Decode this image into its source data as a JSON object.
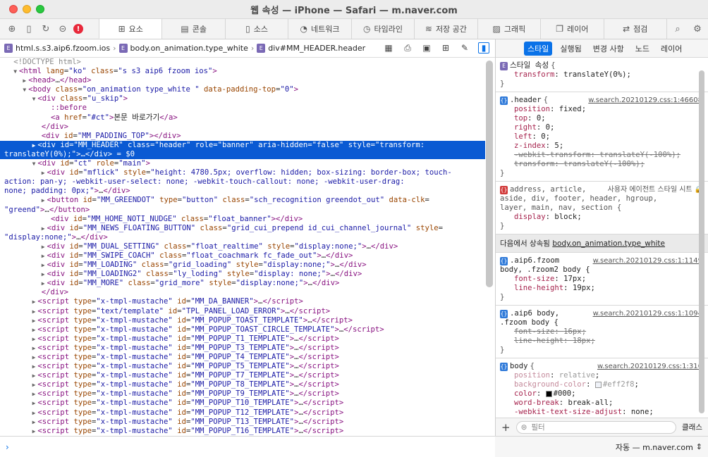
{
  "window": {
    "title": "웹 속성 — iPhone — Safari — m.naver.com"
  },
  "tabbar": {
    "tabs": [
      {
        "label": "요소",
        "icon": "elements-icon",
        "glyph": "⊞",
        "active": true
      },
      {
        "label": "콘솔",
        "icon": "console-icon",
        "glyph": "▤",
        "active": false
      },
      {
        "label": "소스",
        "icon": "sources-icon",
        "glyph": "▯",
        "active": false
      },
      {
        "label": "네트워크",
        "icon": "network-icon",
        "glyph": "◔",
        "active": false
      },
      {
        "label": "타임라인",
        "icon": "timeline-icon",
        "glyph": "◷",
        "active": false
      },
      {
        "label": "저장 공간",
        "icon": "storage-icon",
        "glyph": "≋",
        "active": false
      },
      {
        "label": "그래픽",
        "icon": "graphics-icon",
        "glyph": "▨",
        "active": false
      },
      {
        "label": "레이어",
        "icon": "layers-icon",
        "glyph": "❐",
        "active": false
      },
      {
        "label": "점검",
        "icon": "audit-icon",
        "glyph": "⇄",
        "active": false
      }
    ]
  },
  "breadcrumb": {
    "items": [
      "html.s.s3.aip6.fzoom.ios",
      "body.on_animation.type_white",
      "div#MM_HEADER.header"
    ],
    "badge": "E"
  },
  "dom": {
    "lines": [
      {
        "indent": 2,
        "arrow": "",
        "html": "<span class='cm'>&lt;!DOCTYPE html&gt;</span>"
      },
      {
        "indent": 2,
        "arrow": "▼",
        "html": "<span class='tg'>&lt;html</span> <span class='an'>lang</span>=<span class='av'>\"ko\"</span> <span class='an'>class</span>=<span class='av'>\"s s3 aip6 fzoom ios\"</span><span class='tg'>&gt;</span>"
      },
      {
        "indent": 4,
        "arrow": "▶",
        "html": "<span class='tg'>&lt;head&gt;</span>…<span class='tg'>&lt;/head&gt;</span>"
      },
      {
        "indent": 4,
        "arrow": "▼",
        "html": "<span class='tg'>&lt;body</span> <span class='an'>class</span>=<span class='av'>\"on_animation type_white \"</span> <span class='an'>data-padding-top</span>=<span class='av'>\"0\"</span><span class='tg'>&gt;</span>"
      },
      {
        "indent": 6,
        "arrow": "▼",
        "html": "<span class='tg'>&lt;div</span> <span class='an'>class</span>=<span class='av'>\"u_skip\"</span><span class='tg'>&gt;</span>"
      },
      {
        "indent": 10,
        "arrow": "",
        "html": "<span class='tg'>::before</span>"
      },
      {
        "indent": 10,
        "arrow": "",
        "html": "<span class='tg'>&lt;a</span> <span class='an'>href</span>=<span class='av'>\"#ct\"</span><span class='tg'>&gt;</span><span class='tx'>본문 바로가기</span><span class='tg'>&lt;/a&gt;</span>"
      },
      {
        "indent": 8,
        "arrow": "",
        "html": "<span class='tg'>&lt;/div&gt;</span>"
      },
      {
        "indent": 8,
        "arrow": "",
        "html": "<span class='tg'>&lt;div</span> <span class='an'>id</span>=<span class='av'>\"MM_PADDING_TOP\"</span><span class='tg'>&gt;&lt;/div&gt;</span>"
      },
      {
        "indent": 6,
        "arrow": "▶",
        "selected": true,
        "html": "<span class='tg'>&lt;div</span> <span class='an'>id</span>=<span class='av'>\"MM_HEADER\"</span> <span class='an'>class</span>=<span class='av'>\"header\"</span> <span class='an'>role</span>=<span class='av'>\"banner\"</span> <span class='an'>aria-hidden</span>=<span class='av'>\"false\"</span> <span class='an'>style</span>=<span class='av'>\"transform: </span>"
      },
      {
        "indent": 0,
        "arrow": "",
        "selected": true,
        "html": "<span class='av'>translateY(0%);\"</span><span class='tg'>&gt;</span>…<span class='tg'>&lt;/div&gt;</span> = $0"
      },
      {
        "indent": 6,
        "arrow": "▼",
        "html": "<span class='tg'>&lt;div</span> <span class='an'>id</span>=<span class='av'>\"ct\"</span> <span class='an'>role</span>=<span class='av'>\"main\"</span><span class='tg'>&gt;</span>"
      },
      {
        "indent": 8,
        "arrow": "▶",
        "html": "<span class='tg'>&lt;div</span> <span class='an'>id</span>=<span class='av'>\"mflick\"</span> <span class='an'>style</span>=<span class='av'>\"height: 4780.5px; overflow: hidden; box-sizing: border-box; touch-</span>"
      },
      {
        "indent": 0,
        "arrow": "",
        "html": "<span class='av'>action: pan-y; -webkit-user-select: none; -webkit-touch-callout: none; -webkit-user-drag: </span>"
      },
      {
        "indent": 0,
        "arrow": "",
        "html": "<span class='av'>none; padding: 0px;\"</span><span class='tg'>&gt;</span>…<span class='tg'>&lt;/div&gt;</span>"
      },
      {
        "indent": 8,
        "arrow": "▶",
        "html": "<span class='tg'>&lt;button</span> <span class='an'>id</span>=<span class='av'>\"MM_GREENDOT\"</span> <span class='an'>type</span>=<span class='av'>\"button\"</span> <span class='an'>class</span>=<span class='av'>\"sch_recognition greendot_out\"</span> <span class='an'>data-clk</span>=</span>"
      },
      {
        "indent": 0,
        "arrow": "",
        "html": "<span class='av'>\"greend\"</span><span class='tg'>&gt;</span>…<span class='tg'>&lt;/button&gt;</span>"
      },
      {
        "indent": 10,
        "arrow": "",
        "html": "<span class='tg'>&lt;div</span> <span class='an'>id</span>=<span class='av'>\"MM_HOME_NOTI_NUDGE\"</span> <span class='an'>class</span>=<span class='av'>\"float_banner\"</span><span class='tg'>&gt;&lt;/div&gt;</span>"
      },
      {
        "indent": 8,
        "arrow": "▶",
        "html": "<span class='tg'>&lt;div</span> <span class='an'>id</span>=<span class='av'>\"MM_NEWS_FLOATING_BUTTON\"</span> <span class='an'>class</span>=<span class='av'>\"grid_cui_prepend id_cui_channel_journal\"</span> <span class='an'>style</span>=</span>"
      },
      {
        "indent": 0,
        "arrow": "",
        "html": "<span class='av'>\"display:none;\"</span><span class='tg'>&gt;</span>…<span class='tg'>&lt;/div&gt;</span>"
      },
      {
        "indent": 8,
        "arrow": "▶",
        "html": "<span class='tg'>&lt;div</span> <span class='an'>id</span>=<span class='av'>\"MM_DUAL_SETTING\"</span> <span class='an'>class</span>=<span class='av'>\"float_realtime\"</span> <span class='an'>style</span>=<span class='av'>\"display:none;\"</span><span class='tg'>&gt;</span>…<span class='tg'>&lt;/div&gt;</span>"
      },
      {
        "indent": 8,
        "arrow": "▶",
        "html": "<span class='tg'>&lt;div</span> <span class='an'>id</span>=<span class='av'>\"MM_SWIPE_COACH\"</span> <span class='an'>class</span>=<span class='av'>\"float_coachmark fc_fade_out\"</span><span class='tg'>&gt;</span>…<span class='tg'>&lt;/div&gt;</span>"
      },
      {
        "indent": 8,
        "arrow": "▶",
        "html": "<span class='tg'>&lt;div</span> <span class='an'>id</span>=<span class='av'>\"MM_LOADING\"</span> <span class='an'>class</span>=<span class='av'>\"grid_loading\"</span> <span class='an'>style</span>=<span class='av'>\"display:none;\"</span><span class='tg'>&gt;</span>…<span class='tg'>&lt;/div&gt;</span>"
      },
      {
        "indent": 8,
        "arrow": "▶",
        "html": "<span class='tg'>&lt;div</span> <span class='an'>id</span>=<span class='av'>\"MM_LOADING2\"</span> <span class='an'>class</span>=<span class='av'>\"ly_loding\"</span> <span class='an'>style</span>=<span class='av'>\"display: none;\"</span><span class='tg'>&gt;</span>…<span class='tg'>&lt;/div&gt;</span>"
      },
      {
        "indent": 8,
        "arrow": "▶",
        "html": "<span class='tg'>&lt;div</span> <span class='an'>id</span>=<span class='av'>\"MM_MORE\"</span> <span class='an'>class</span>=<span class='av'>\"grid_more\"</span> <span class='an'>style</span>=<span class='av'>\"display:none;\"</span><span class='tg'>&gt;</span>…<span class='tg'>&lt;/div&gt;</span>"
      },
      {
        "indent": 8,
        "arrow": "",
        "html": "<span class='tg'>&lt;/div&gt;</span>"
      },
      {
        "indent": 6,
        "arrow": "▶",
        "html": "<span class='tg'>&lt;script</span> <span class='an'>type</span>=<span class='av'>\"x-tmpl-mustache\"</span> <span class='an'>id</span>=<span class='av'>\"MM_DA_BANNER\"</span><span class='tg'>&gt;</span>…<span class='tg'>&lt;/script&gt;</span>"
      },
      {
        "indent": 6,
        "arrow": "▶",
        "html": "<span class='tg'>&lt;script</span> <span class='an'>type</span>=<span class='av'>\"text/template\"</span> <span class='an'>id</span>=<span class='av'>\"TPL_PANEL_LOAD_ERROR\"</span><span class='tg'>&gt;</span>…<span class='tg'>&lt;/script&gt;</span>"
      },
      {
        "indent": 6,
        "arrow": "▶",
        "html": "<span class='tg'>&lt;script</span> <span class='an'>type</span>=<span class='av'>\"x-tmpl-mustache\"</span> <span class='an'>id</span>=<span class='av'>\"MM_POPUP_TOAST_TEMPLATE\"</span><span class='tg'>&gt;</span>…<span class='tg'>&lt;/script&gt;</span>"
      },
      {
        "indent": 6,
        "arrow": "▶",
        "html": "<span class='tg'>&lt;script</span> <span class='an'>type</span>=<span class='av'>\"x-tmpl-mustache\"</span> <span class='an'>id</span>=<span class='av'>\"MM_POPUP_TOAST_CIRCLE_TEMPLATE\"</span><span class='tg'>&gt;</span>…<span class='tg'>&lt;/script&gt;</span>"
      },
      {
        "indent": 6,
        "arrow": "▶",
        "html": "<span class='tg'>&lt;script</span> <span class='an'>type</span>=<span class='av'>\"x-tmpl-mustache\"</span> <span class='an'>id</span>=<span class='av'>\"MM_POPUP_T1_TEMPLATE\"</span><span class='tg'>&gt;</span>…<span class='tg'>&lt;/script&gt;</span>"
      },
      {
        "indent": 6,
        "arrow": "▶",
        "html": "<span class='tg'>&lt;script</span> <span class='an'>type</span>=<span class='av'>\"x-tmpl-mustache\"</span> <span class='an'>id</span>=<span class='av'>\"MM_POPUP_T3_TEMPLATE\"</span><span class='tg'>&gt;</span>…<span class='tg'>&lt;/script&gt;</span>"
      },
      {
        "indent": 6,
        "arrow": "▶",
        "html": "<span class='tg'>&lt;script</span> <span class='an'>type</span>=<span class='av'>\"x-tmpl-mustache\"</span> <span class='an'>id</span>=<span class='av'>\"MM_POPUP_T4_TEMPLATE\"</span><span class='tg'>&gt;</span>…<span class='tg'>&lt;/script&gt;</span>"
      },
      {
        "indent": 6,
        "arrow": "▶",
        "html": "<span class='tg'>&lt;script</span> <span class='an'>type</span>=<span class='av'>\"x-tmpl-mustache\"</span> <span class='an'>id</span>=<span class='av'>\"MM_POPUP_T5_TEMPLATE\"</span><span class='tg'>&gt;</span>…<span class='tg'>&lt;/script&gt;</span>"
      },
      {
        "indent": 6,
        "arrow": "▶",
        "html": "<span class='tg'>&lt;script</span> <span class='an'>type</span>=<span class='av'>\"x-tmpl-mustache\"</span> <span class='an'>id</span>=<span class='av'>\"MM_POPUP_T7_TEMPLATE\"</span><span class='tg'>&gt;</span>…<span class='tg'>&lt;/script&gt;</span>"
      },
      {
        "indent": 6,
        "arrow": "▶",
        "html": "<span class='tg'>&lt;script</span> <span class='an'>type</span>=<span class='av'>\"x-tmpl-mustache\"</span> <span class='an'>id</span>=<span class='av'>\"MM_POPUP_T8_TEMPLATE\"</span><span class='tg'>&gt;</span>…<span class='tg'>&lt;/script&gt;</span>"
      },
      {
        "indent": 6,
        "arrow": "▶",
        "html": "<span class='tg'>&lt;script</span> <span class='an'>type</span>=<span class='av'>\"x-tmpl-mustache\"</span> <span class='an'>id</span>=<span class='av'>\"MM_POPUP_T9_TEMPLATE\"</span><span class='tg'>&gt;</span>…<span class='tg'>&lt;/script&gt;</span>"
      },
      {
        "indent": 6,
        "arrow": "▶",
        "html": "<span class='tg'>&lt;script</span> <span class='an'>type</span>=<span class='av'>\"x-tmpl-mustache\"</span> <span class='an'>id</span>=<span class='av'>\"MM_POPUP_T10_TEMPLATE\"</span><span class='tg'>&gt;</span>…<span class='tg'>&lt;/script&gt;</span>"
      },
      {
        "indent": 6,
        "arrow": "▶",
        "html": "<span class='tg'>&lt;script</span> <span class='an'>type</span>=<span class='av'>\"x-tmpl-mustache\"</span> <span class='an'>id</span>=<span class='av'>\"MM_POPUP_T12_TEMPLATE\"</span><span class='tg'>&gt;</span>…<span class='tg'>&lt;/script&gt;</span>"
      },
      {
        "indent": 6,
        "arrow": "▶",
        "html": "<span class='tg'>&lt;script</span> <span class='an'>type</span>=<span class='av'>\"x-tmpl-mustache\"</span> <span class='an'>id</span>=<span class='av'>\"MM_POPUP_T13_TEMPLATE\"</span><span class='tg'>&gt;</span>…<span class='tg'>&lt;/script&gt;</span>"
      },
      {
        "indent": 6,
        "arrow": "▶",
        "html": "<span class='tg'>&lt;script</span> <span class='an'>type</span>=<span class='av'>\"x-tmpl-mustache\"</span> <span class='an'>id</span>=<span class='av'>\"MM_POPUP_T16_TEMPLATE\"</span><span class='tg'>&gt;</span>…<span class='tg'>&lt;/script&gt;</span>"
      }
    ]
  },
  "sidebar": {
    "tabs": [
      {
        "label": "스타일",
        "active": true
      },
      {
        "label": "실행됨",
        "active": false
      },
      {
        "label": "변경 사항",
        "active": false
      },
      {
        "label": "노드",
        "active": false
      },
      {
        "label": "레이어",
        "active": false
      }
    ],
    "style_attr": {
      "selector": "스타일 속성",
      "badge": "E",
      "props": [
        {
          "name": "transform",
          "value": "translateY(0%)"
        }
      ]
    },
    "header_rule": {
      "selector": ".header",
      "badge": "{}",
      "source": "w.search.20210129.css:1:46608",
      "props": [
        {
          "name": "position",
          "value": "fixed",
          "struck": false
        },
        {
          "name": "top",
          "value": "0",
          "struck": false
        },
        {
          "name": "right",
          "value": "0",
          "struck": false
        },
        {
          "name": "left",
          "value": "0",
          "struck": false
        },
        {
          "name": "z-index",
          "value": "5",
          "struck": false
        },
        {
          "name": "-webkit-transform",
          "value": "translateY(-100%)",
          "struck": true
        },
        {
          "name": "transform",
          "value": "translateY(-100%)",
          "struck": true
        }
      ]
    },
    "ua_rule": {
      "selector_line1": "address, article,",
      "selector_line2": "aside, div, footer, header, hgroup,",
      "selector_line3": "layer, main, nav, section",
      "label": "사용자 에이전트 스타일 시트",
      "badge": "{}",
      "props": [
        {
          "name": "display",
          "value": "block"
        }
      ]
    },
    "inherited": {
      "prefix": "다음에서 상속됨",
      "target": "body.on_animation.type_white"
    },
    "body_fzoom": {
      "selector_line1": ".aip6.fzoom",
      "selector_line2": "body, .fzoom2 body",
      "source": "w.search.20210129.css:1:1149",
      "badge": "{}",
      "props": [
        {
          "name": "font-size",
          "value": "17px"
        },
        {
          "name": "line-height",
          "value": "19px"
        }
      ]
    },
    "aip6_body": {
      "selector_line1": ".aip6 body,",
      "selector_line2": ".fzoom body",
      "source": "w.search.20210129.css:1:1094",
      "badge": "{}",
      "props": [
        {
          "name": "font-size",
          "value": "16px"
        },
        {
          "name": "line-height",
          "value": "18px"
        }
      ]
    },
    "body_rule": {
      "selector": "body",
      "source": "w.search.20210129.css:1:316",
      "badge": "{}",
      "props": [
        {
          "name": "position",
          "value": "relative",
          "dim": true
        },
        {
          "name": "background-color",
          "value": "#eff2f8",
          "dim": true,
          "swatch": "#eff2f8"
        },
        {
          "name": "color",
          "value": "#000",
          "dim": false,
          "swatch": "#000000"
        },
        {
          "name": "word-break",
          "value": "break-all",
          "dim": false
        },
        {
          "name": "-webkit-text-size-adjust",
          "value": "none",
          "dim": false
        }
      ]
    },
    "filter_placeholder": "필터",
    "classes_label": "클래스"
  },
  "status": {
    "target_label": "자동 — m.naver.com"
  },
  "colors": {
    "accent": "#0a72e8",
    "selection": "#0a5ad3",
    "error": "#e8283a"
  }
}
